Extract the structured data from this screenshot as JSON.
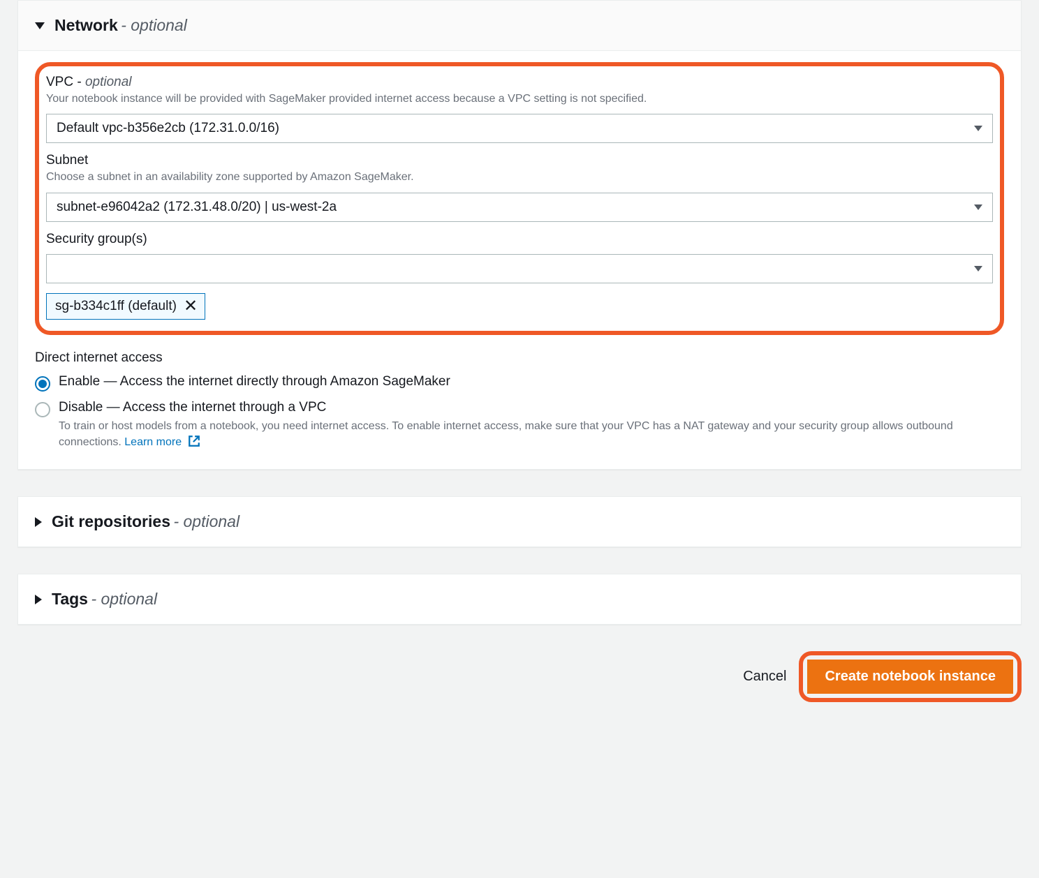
{
  "network": {
    "title": "Network",
    "optional": "- optional",
    "vpc": {
      "label": "VPC -",
      "optional": "optional",
      "hint": "Your notebook instance will be provided with SageMaker provided internet access because a VPC setting is not specified.",
      "value": "Default vpc-b356e2cb (172.31.0.0/16)"
    },
    "subnet": {
      "label": "Subnet",
      "hint": "Choose a subnet in an availability zone supported by Amazon SageMaker.",
      "value": "subnet-e96042a2 (172.31.48.0/20) | us-west-2a"
    },
    "securityGroups": {
      "label": "Security group(s)",
      "value": "",
      "token": "sg-b334c1ff (default)"
    },
    "directInternet": {
      "label": "Direct internet access",
      "options": {
        "enable": "Enable — Access the internet directly through Amazon SageMaker",
        "disable": "Disable — Access the internet through a VPC",
        "disableDesc": "To train or host models from a notebook, you need internet access. To enable internet access, make sure that your VPC has a NAT gateway and your security group allows outbound connections.  ",
        "learnMore": "Learn more"
      }
    }
  },
  "git": {
    "title": "Git repositories",
    "optional": "- optional"
  },
  "tags": {
    "title": "Tags",
    "optional": "- optional"
  },
  "footer": {
    "cancel": "Cancel",
    "create": "Create notebook instance"
  }
}
